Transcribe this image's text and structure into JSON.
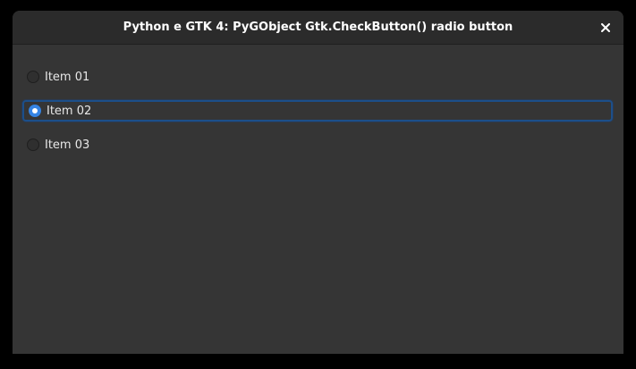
{
  "window": {
    "title": "Python e GTK 4: PyGObject Gtk.CheckButton() radio button",
    "close_icon": "close-icon"
  },
  "radios": [
    {
      "label": "Item 01",
      "checked": false
    },
    {
      "label": "Item 02",
      "checked": true
    },
    {
      "label": "Item 03",
      "checked": false
    }
  ],
  "colors": {
    "window_bg": "#353535",
    "titlebar_bg": "#2b2b2b",
    "accent": "#3584e4",
    "focus_ring": "#1c4f8a",
    "text": "#e8e8e8"
  }
}
